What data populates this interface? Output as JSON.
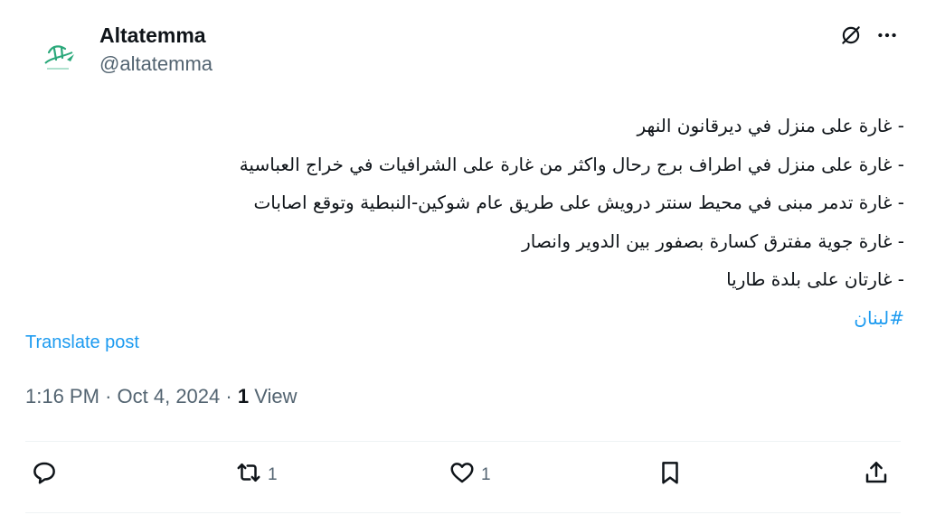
{
  "author": {
    "display_name": "Altatemma",
    "handle": "@altatemma",
    "avatar_text": "التتمة"
  },
  "header_icons": [
    "grok-icon",
    "more-icon"
  ],
  "post": {
    "lines": [
      "- غارة على منزل في ديرقانون النهر",
      "- غارة على منزل في اطراف برج رحال واكثر من غارة على الشرافيات في خراج العباسية",
      "- غارة تدمر مبنى في محيط سنتر درويش على طريق عام شوكين-النبطية وتوقع اصابات",
      "- غارة جوية مفترق كسارة بصفور بين الدوير وانصار",
      "- غارتان على بلدة طاريا"
    ],
    "hashtag": "#لبنان"
  },
  "translate_label": "Translate post",
  "meta": {
    "time": "1:16 PM",
    "separator": "·",
    "date": "Oct 4, 2024",
    "views_count": "1",
    "views_label": "View"
  },
  "actions": {
    "reply_count": "",
    "repost_count": "1",
    "like_count": "1"
  },
  "colors": {
    "accent": "#1d9bf0",
    "secondary_text": "#536471",
    "primary_text": "#0f1419"
  }
}
